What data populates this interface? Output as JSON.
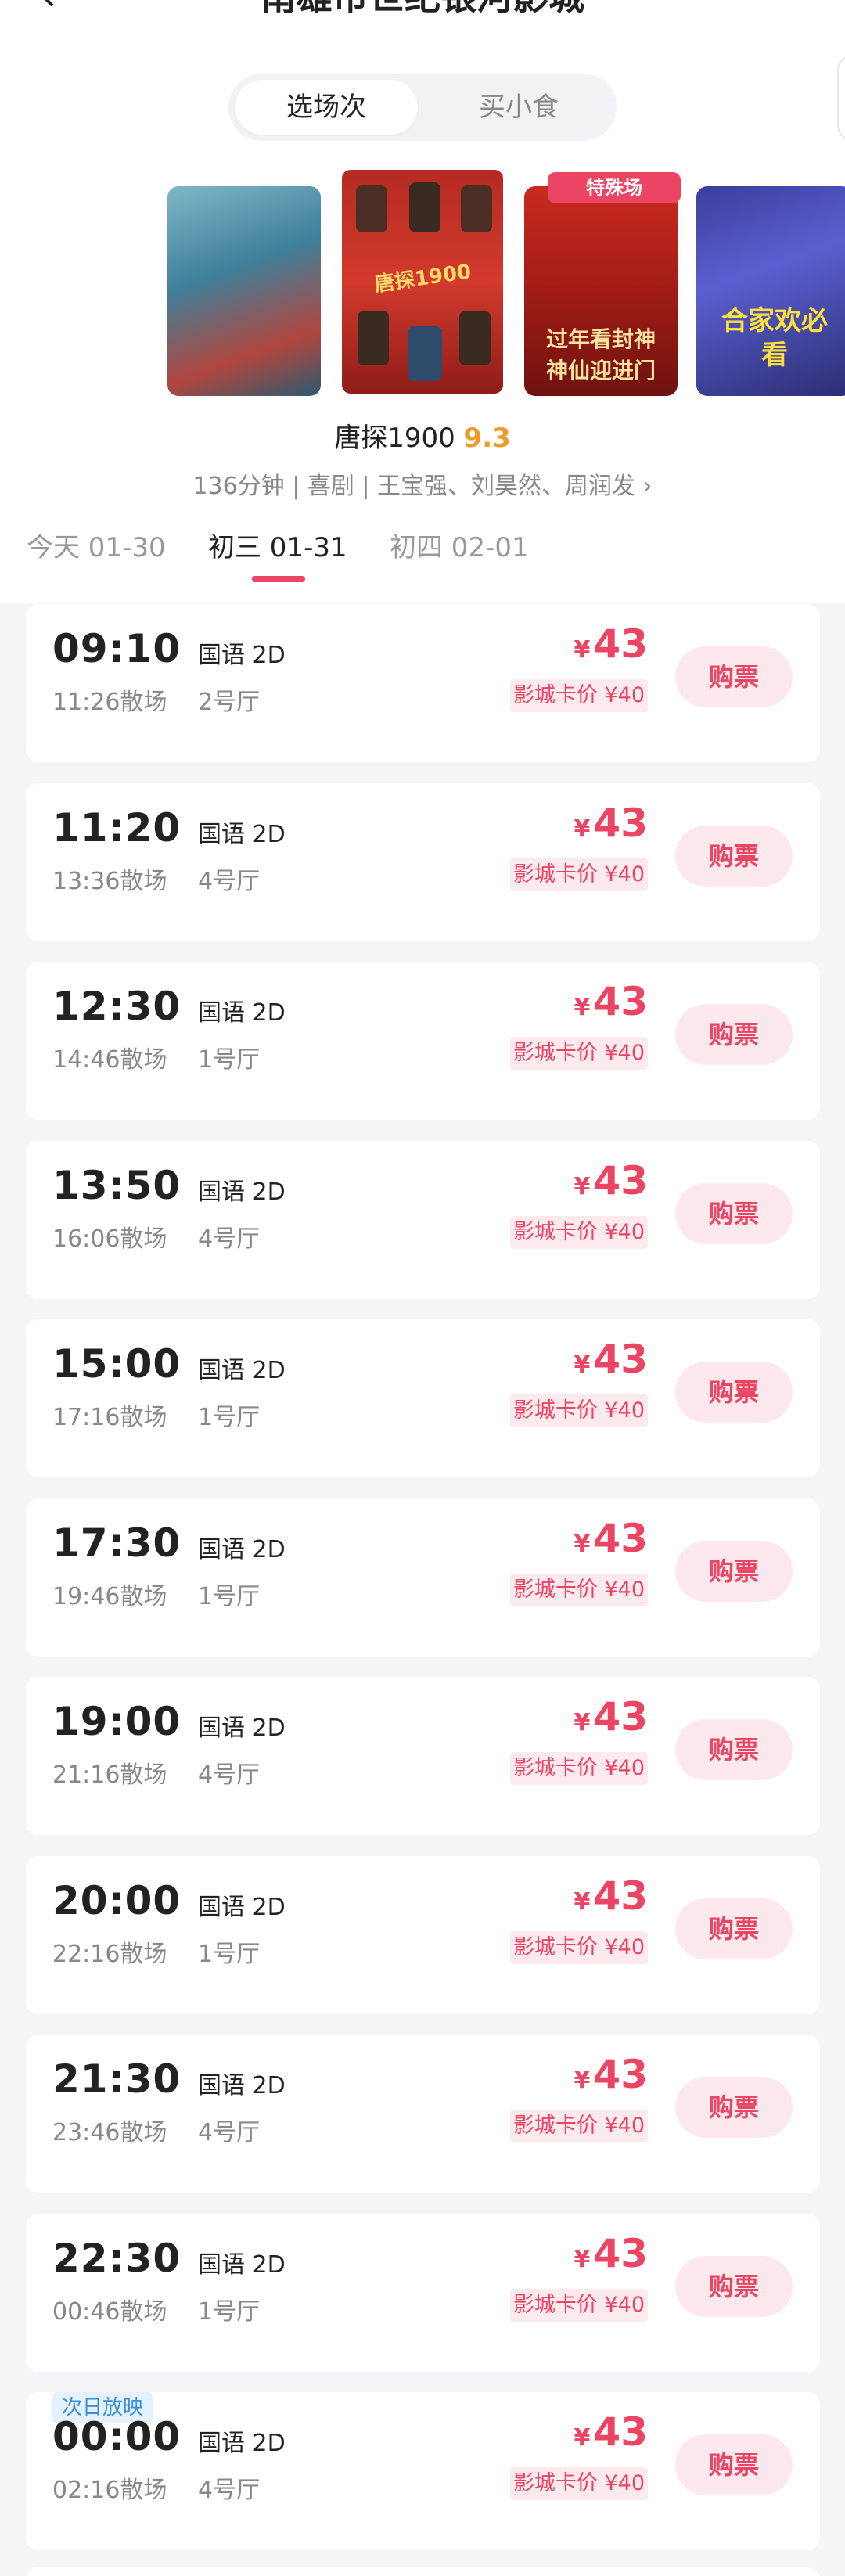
{
  "header": {
    "title": "南雄市世纪银河影城"
  },
  "segment": {
    "active_label": "选场次",
    "inactive_label": "买小食"
  },
  "posters": [
    {
      "text": ""
    },
    {
      "text": "唐探1900"
    },
    {
      "text": "过年看封神 神仙迎进门"
    },
    {
      "text": "合家欢必看"
    }
  ],
  "special_tag": "特殊场",
  "movie": {
    "title": "唐探1900",
    "score": "9.3",
    "meta": "136分钟 | 喜剧 | 王宝强、刘昊然、周润发 ›"
  },
  "dates": [
    {
      "label": "今天 01-30"
    },
    {
      "label": "初三 01-31"
    },
    {
      "label": "初四 02-01"
    }
  ],
  "sessions": [
    {
      "time": "09:10",
      "end": "11:26散场",
      "lang": "国语 2D",
      "hall": "2号厅",
      "price": "43",
      "member_price": "影城卡价 ¥40",
      "buy": "购票"
    },
    {
      "time": "11:20",
      "end": "13:36散场",
      "lang": "国语 2D",
      "hall": "4号厅",
      "price": "43",
      "member_price": "影城卡价 ¥40",
      "buy": "购票"
    },
    {
      "time": "12:30",
      "end": "14:46散场",
      "lang": "国语 2D",
      "hall": "1号厅",
      "price": "43",
      "member_price": "影城卡价 ¥40",
      "buy": "购票"
    },
    {
      "time": "13:50",
      "end": "16:06散场",
      "lang": "国语 2D",
      "hall": "4号厅",
      "price": "43",
      "member_price": "影城卡价 ¥40",
      "buy": "购票"
    },
    {
      "time": "15:00",
      "end": "17:16散场",
      "lang": "国语 2D",
      "hall": "1号厅",
      "price": "43",
      "member_price": "影城卡价 ¥40",
      "buy": "购票"
    },
    {
      "time": "17:30",
      "end": "19:46散场",
      "lang": "国语 2D",
      "hall": "1号厅",
      "price": "43",
      "member_price": "影城卡价 ¥40",
      "buy": "购票"
    },
    {
      "time": "19:00",
      "end": "21:16散场",
      "lang": "国语 2D",
      "hall": "4号厅",
      "price": "43",
      "member_price": "影城卡价 ¥40",
      "buy": "购票"
    },
    {
      "time": "20:00",
      "end": "22:16散场",
      "lang": "国语 2D",
      "hall": "1号厅",
      "price": "43",
      "member_price": "影城卡价 ¥40",
      "buy": "购票"
    },
    {
      "time": "21:30",
      "end": "23:46散场",
      "lang": "国语 2D",
      "hall": "4号厅",
      "price": "43",
      "member_price": "影城卡价 ¥40",
      "buy": "购票"
    },
    {
      "time": "22:30",
      "end": "00:46散场",
      "lang": "国语 2D",
      "hall": "1号厅",
      "price": "43",
      "member_price": "影城卡价 ¥40",
      "buy": "购票"
    },
    {
      "time": "00:00",
      "end": "02:16散场",
      "lang": "国语 2D",
      "hall": "4号厅",
      "price": "43",
      "member_price": "影城卡价 ¥40",
      "buy": "购票",
      "tag": "次日放映"
    }
  ],
  "currency_symbol": "¥",
  "colors": {
    "accent": "#ec4463",
    "score": "#f09a2a",
    "next_day_tag": "#3b8fd9"
  }
}
